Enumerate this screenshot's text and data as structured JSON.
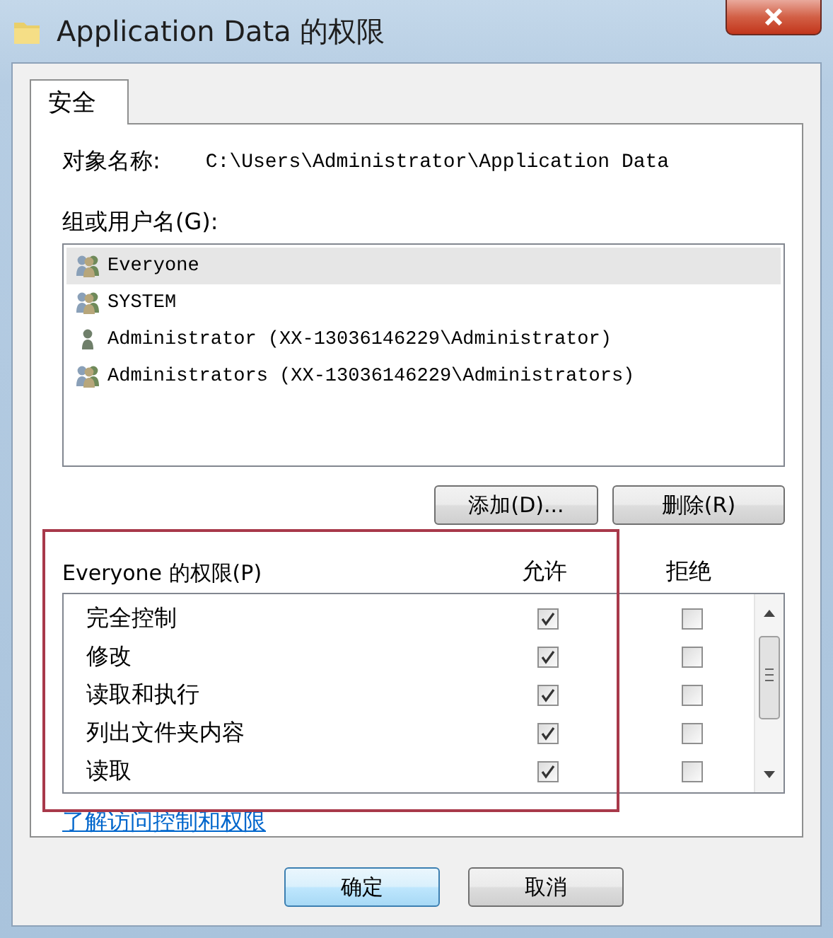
{
  "window": {
    "title": "Application Data 的权限"
  },
  "tabs": [
    {
      "label": "安全",
      "selected": true
    }
  ],
  "object_name": {
    "label": "对象名称:",
    "value": "C:\\Users\\Administrator\\Application Data"
  },
  "users": {
    "label": "组或用户名(G):",
    "items": [
      {
        "name": "Everyone",
        "kind": "group",
        "selected": true
      },
      {
        "name": "SYSTEM",
        "kind": "group",
        "selected": false
      },
      {
        "name": "Administrator (XX-13036146229\\Administrator)",
        "kind": "user",
        "selected": false
      },
      {
        "name": "Administrators (XX-13036146229\\Administrators)",
        "kind": "group",
        "selected": false
      }
    ]
  },
  "user_buttons": [
    "添加(D)...",
    "删除(R)"
  ],
  "permissions": {
    "label": "Everyone 的权限(P)",
    "allow_header": "允许",
    "deny_header": "拒绝",
    "rows": [
      {
        "name": "完全控制",
        "allow": true,
        "deny": false
      },
      {
        "name": "修改",
        "allow": true,
        "deny": false
      },
      {
        "name": "读取和执行",
        "allow": true,
        "deny": false
      },
      {
        "name": "列出文件夹内容",
        "allow": true,
        "deny": false
      },
      {
        "name": "读取",
        "allow": true,
        "deny": false
      }
    ]
  },
  "link": "了解访问控制和权限",
  "buttons": [
    "确定",
    "取消"
  ]
}
